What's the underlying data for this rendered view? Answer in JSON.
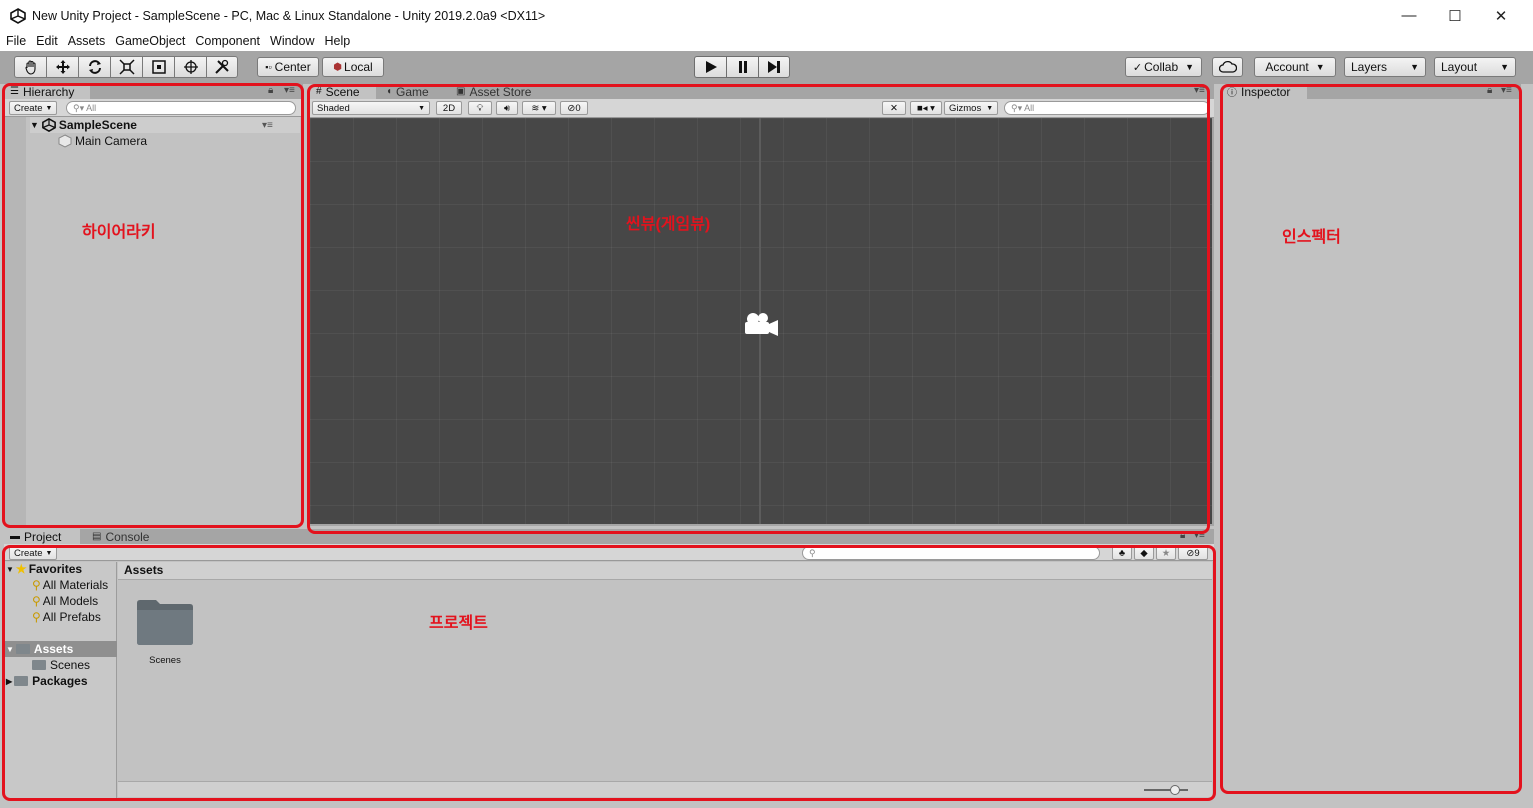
{
  "window": {
    "title": "New Unity Project - SampleScene - PC, Mac & Linux Standalone - Unity 2019.2.0a9 <DX11>",
    "minimize": "—",
    "maximize": "☐",
    "close": "✕"
  },
  "menu": [
    "File",
    "Edit",
    "Assets",
    "GameObject",
    "Component",
    "Window",
    "Help"
  ],
  "toolbar": {
    "pivot": "Center",
    "space": "Local",
    "collab": "Collab",
    "account": "Account",
    "layers": "Layers",
    "layout": "Layout"
  },
  "hierarchy": {
    "tab": "Hierarchy",
    "create": "Create",
    "search_placeholder": "All",
    "scene": "SampleScene",
    "items": [
      "Main Camera"
    ]
  },
  "scene_view": {
    "tabs": [
      "Scene",
      "Game",
      "Asset Store"
    ],
    "shading": "Shaded",
    "mode_2d": "2D",
    "hidden_count": "0",
    "gizmos": "Gizmos",
    "search_placeholder": "All"
  },
  "inspector": {
    "tab": "Inspector"
  },
  "project": {
    "tabs": [
      "Project",
      "Console"
    ],
    "create": "Create",
    "hidden_count": "9",
    "favorites": "Favorites",
    "favorite_items": [
      "All Materials",
      "All Models",
      "All Prefabs"
    ],
    "assets_root": "Assets",
    "asset_children": [
      "Scenes"
    ],
    "packages": "Packages",
    "breadcrumb": "Assets",
    "grid_items": [
      "Scenes"
    ]
  },
  "annotations": {
    "hierarchy": "하이어라키",
    "scene": "씬뷰(게임뷰)",
    "inspector": "인스펙터",
    "project": "프로젝트"
  },
  "colors": {
    "annotation_red": "#e3121d",
    "scene_bg": "#474747",
    "panel_bg": "#c2c2c2"
  }
}
